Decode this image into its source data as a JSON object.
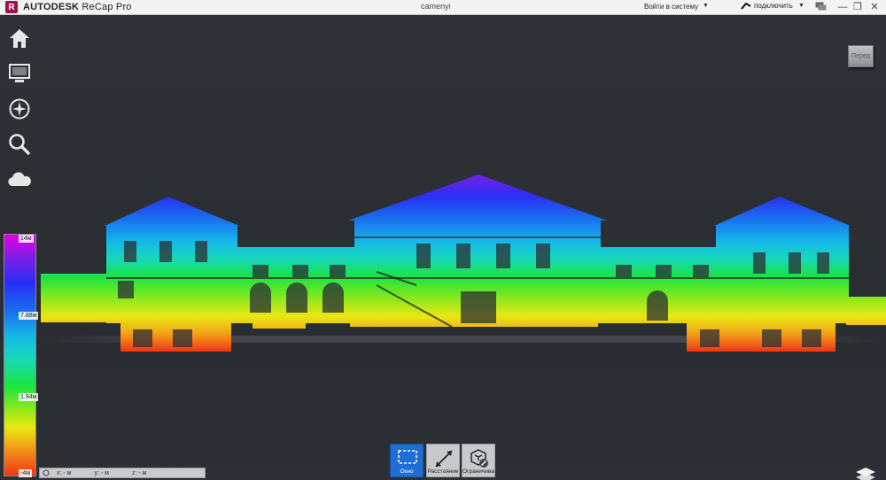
{
  "titlebar": {
    "logo_letter": "R",
    "brand": "AUTODESK",
    "product": "ReCap Pro",
    "document": "camenyi",
    "signin_label": "Войти в систему",
    "connect_label": "подключить",
    "minimize": "—",
    "restore": "❐",
    "close": "✕"
  },
  "viewcube": {
    "label": "Перед"
  },
  "colorscale": {
    "labels": [
      "14м",
      "7.88м",
      "1.94м",
      "-4м"
    ],
    "gradient": [
      "#e400e6",
      "#7a1fe6",
      "#2a2ef5",
      "#1a6fef",
      "#14b9e8",
      "#17d9b8",
      "#1be43c",
      "#8ae81c",
      "#e8e812",
      "#f2a019",
      "#ef3416"
    ]
  },
  "coords": {
    "x": "x: - м",
    "y": "y: - м",
    "z": "z: - м"
  },
  "tools": [
    {
      "label": "Окно",
      "active": true
    },
    {
      "label": "Расстояние",
      "active": false
    },
    {
      "label": "Ограничива",
      "active": false
    }
  ],
  "colors": {
    "accent": "#1f6ed4",
    "background": "#2b2e33"
  }
}
